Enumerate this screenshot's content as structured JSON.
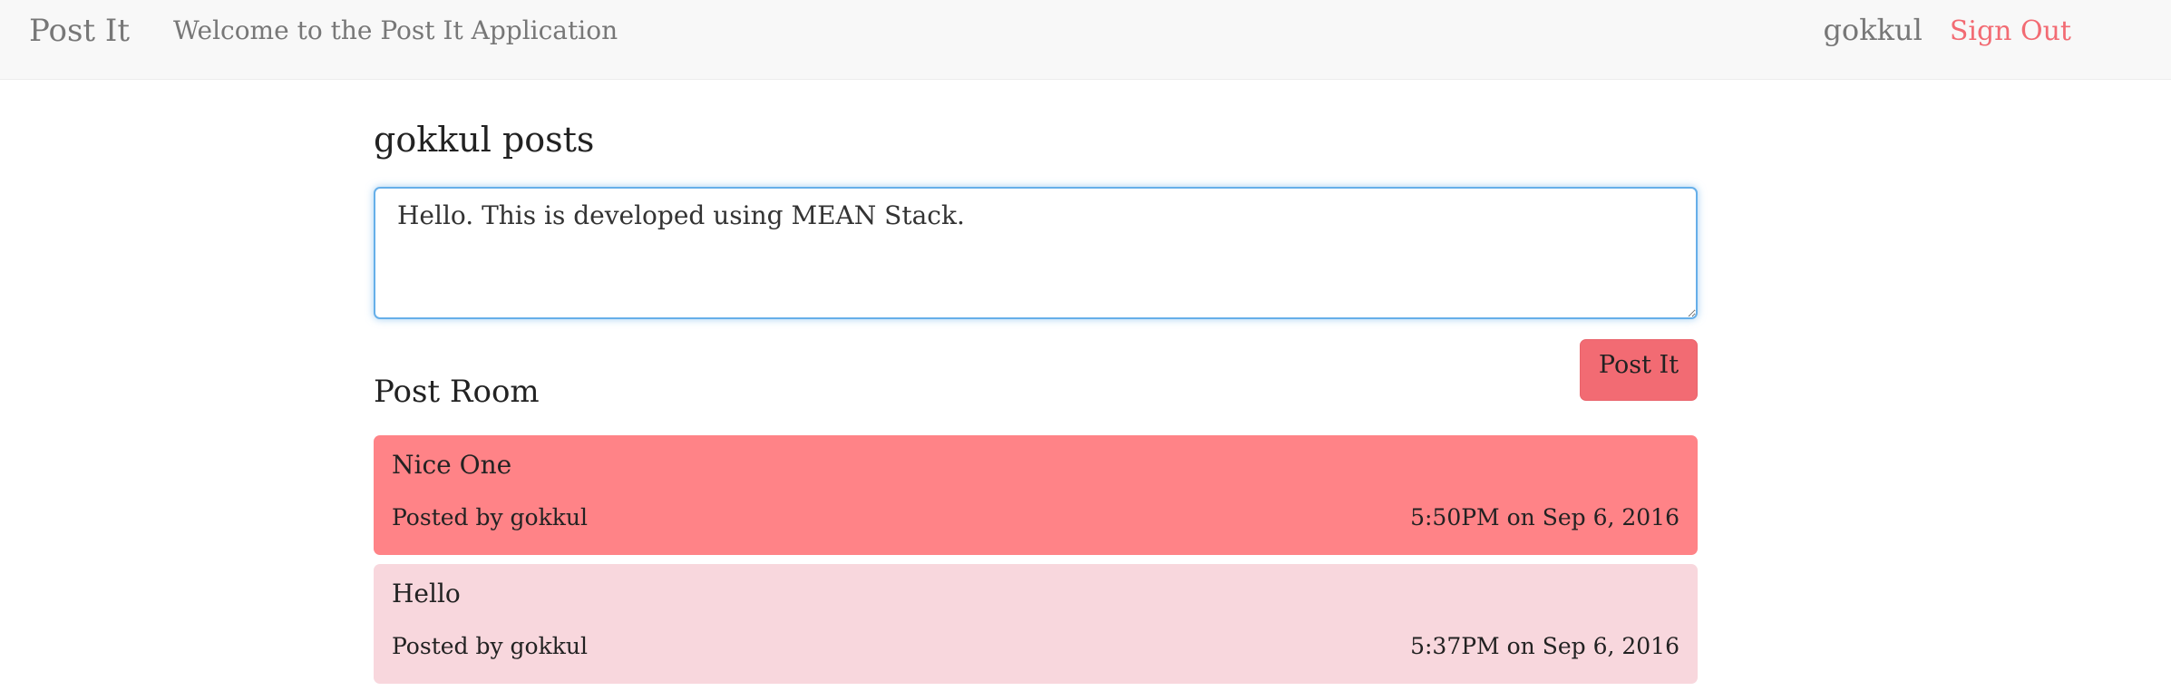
{
  "navbar": {
    "brand": "Post It",
    "welcome": "Welcome to the Post It Application",
    "username": "gokkul",
    "sign_out": "Sign Out"
  },
  "main": {
    "title": "gokkul posts",
    "input_value": "Hello. This is developed using MEAN Stack.",
    "post_button": "Post It",
    "room_title": "Post Room"
  },
  "posts": [
    {
      "text": "Nice One",
      "author": "Posted by gokkul",
      "time": "5:50PM on Sep 6, 2016"
    },
    {
      "text": "Hello",
      "author": "Posted by gokkul",
      "time": "5:37PM on Sep 6, 2016"
    }
  ],
  "colors": {
    "accent": "#f26b73",
    "post_highlight": "#ff8387",
    "post_normal": "#f8d7dd",
    "focus_border": "#66afe9",
    "navbar_bg": "#f8f8f8"
  }
}
